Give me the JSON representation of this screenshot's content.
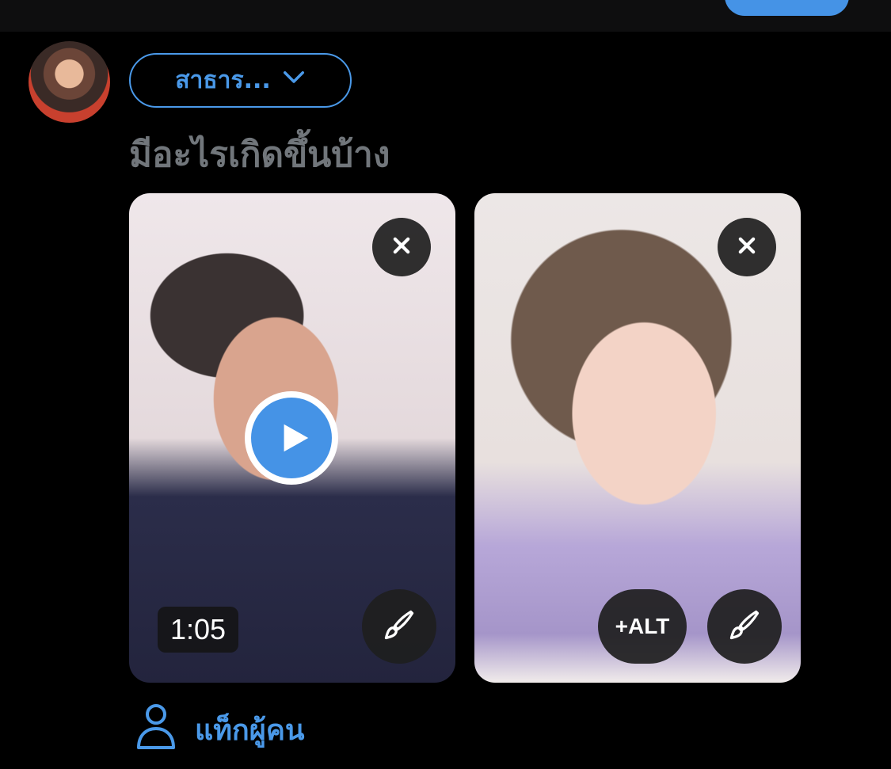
{
  "composer": {
    "audience_label": "สาธาร...",
    "placeholder": "มีอะไรเกิดขึ้นบ้าง",
    "media": [
      {
        "type": "video",
        "duration": "1:05"
      },
      {
        "type": "image",
        "alt_label": "+ALT"
      }
    ],
    "tag_people_label": "แท็กผู้คน"
  },
  "icons": {
    "audience_chevron": "chevron-down-icon",
    "close": "close-icon",
    "edit": "paintbrush-icon",
    "play": "play-icon",
    "tag_people": "person-icon"
  },
  "colors": {
    "background": "#000000",
    "accent": "#4a99e9",
    "placeholder": "#71767b",
    "overlay_button": "#1e1e1e"
  }
}
